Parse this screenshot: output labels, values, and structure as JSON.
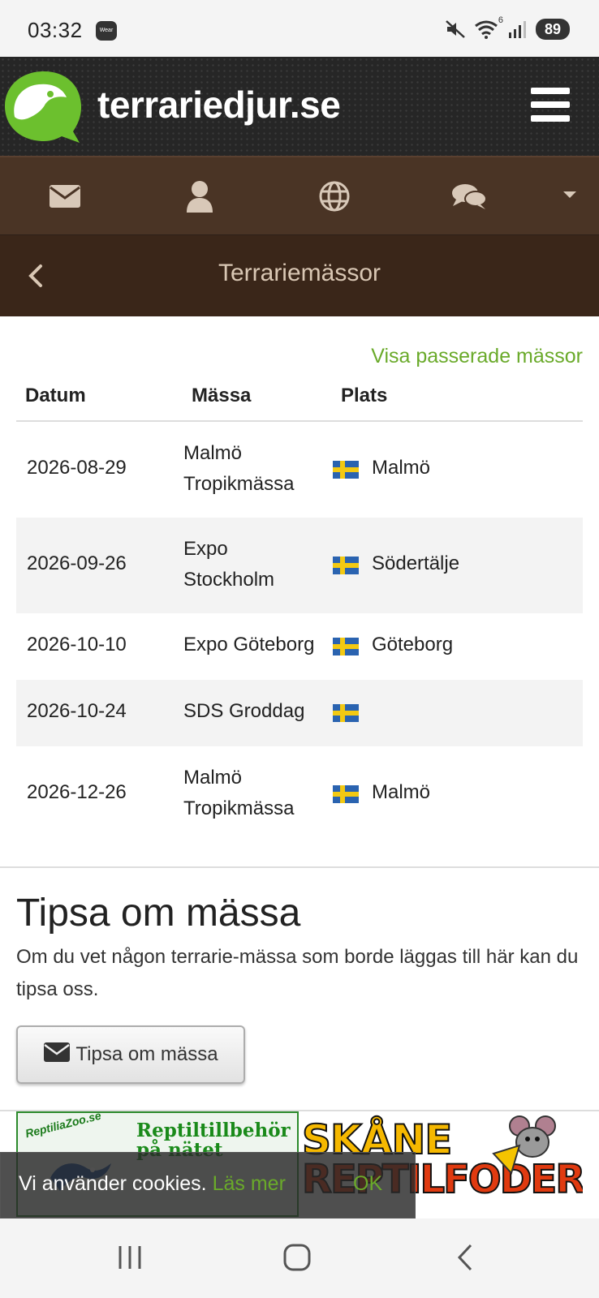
{
  "status_bar": {
    "time": "03:32",
    "wear_badge": "Wear",
    "network_label": "6",
    "battery": "89",
    "icons": [
      "mute-icon",
      "wifi-icon",
      "signal-icon",
      "battery-icon"
    ]
  },
  "header": {
    "logo_text": "terrariedjur.se",
    "menu_icon": "hamburger-icon"
  },
  "nav_icons": [
    "envelope-icon",
    "user-icon",
    "globe-icon",
    "chat-icon",
    "caret-down-icon"
  ],
  "title_bar": {
    "title": "Terrariemässor",
    "back_icon": "chevron-left-icon"
  },
  "show_past_link": "Visa passerade mässor",
  "table": {
    "columns": [
      "Datum",
      "Mässa",
      "Plats"
    ],
    "rows": [
      {
        "date": "2026-08-29",
        "fair_line1": "Malmö",
        "fair_line2": "Tropikmässa",
        "place": "Malmö"
      },
      {
        "date": "2026-09-26",
        "fair_line1": "Expo",
        "fair_line2": "Stockholm",
        "place": "Södertälje"
      },
      {
        "date": "2026-10-10",
        "fair_line1": "Expo Göteborg",
        "fair_line2": "",
        "place": "Göteborg"
      },
      {
        "date": "2026-10-24",
        "fair_line1": "SDS Groddag",
        "fair_line2": "",
        "place": ""
      },
      {
        "date": "2026-12-26",
        "fair_line1": "Malmö",
        "fair_line2": "Tropikmässa",
        "place": "Malmö"
      }
    ]
  },
  "tip": {
    "title": "Tipsa om mässa",
    "text": "Om du vet någon terrarie-mässa som borde läggas till här kan du tipsa oss.",
    "button_label": "Tipsa om mässa"
  },
  "ads": {
    "left_brand": "ReptiliaZoo.se",
    "left_slogan_line1": "Reptiltillbehör",
    "left_slogan_line2": "på nätet",
    "right_line1": "SKÅNE",
    "right_line2": "REPTILFODER"
  },
  "cookie": {
    "text": "Vi använder cookies.",
    "link": "Läs mer",
    "ok": "OK"
  },
  "colors": {
    "accent_green": "#6aaa2a",
    "nav_brown": "#4a3425",
    "title_brown": "#3a2619"
  }
}
